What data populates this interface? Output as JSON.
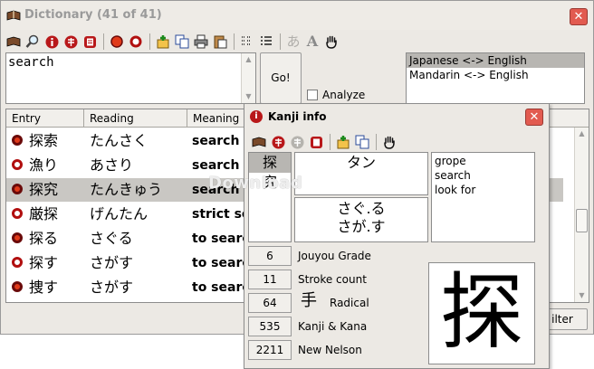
{
  "main_window": {
    "title": "Dictionary (41 of 41)",
    "close_label": "✕"
  },
  "toolbar": {
    "icons": [
      "book-icon",
      "magnifier-icon",
      "info-icon",
      "sound-icon",
      "jump-icon",
      "record-icon",
      "record-outline-icon",
      "add-icon",
      "copy-icon",
      "print-icon",
      "paste-icon",
      "grid-icon",
      "list-icon",
      "font-a-light-icon",
      "font-a-icon",
      "hand-icon"
    ]
  },
  "search": {
    "value": "search"
  },
  "go_button": {
    "label": "Go!"
  },
  "analyze": {
    "label": "Analyze",
    "checked": false
  },
  "languages": {
    "items": [
      "Japanese <-> English",
      "Mandarin <-> English"
    ],
    "selected_index": 0
  },
  "results": {
    "columns": [
      "Entry",
      "Reading",
      "Meaning"
    ],
    "rows": [
      {
        "entry": "探索",
        "reading": "たんさく",
        "meaning": "search",
        "dot": "filled",
        "selected": false
      },
      {
        "entry": "漁り",
        "reading": "あさり",
        "meaning": "search",
        "dot": "outline",
        "selected": false
      },
      {
        "entry": "探究",
        "reading": "たんきゅう",
        "meaning": "search",
        "dot": "filled",
        "selected": true
      },
      {
        "entry": "厳探",
        "reading": "げんたん",
        "meaning": "strict se",
        "dot": "outline",
        "selected": false
      },
      {
        "entry": "探る",
        "reading": "さぐる",
        "meaning": "to searc",
        "dot": "filled",
        "selected": false
      },
      {
        "entry": "探す",
        "reading": "さがす",
        "meaning": "to searc",
        "dot": "outline",
        "selected": false
      },
      {
        "entry": "捜す",
        "reading": "さがす",
        "meaning": "to searc",
        "dot": "filled",
        "selected": false
      }
    ]
  },
  "filter_button": {
    "label": "ilter"
  },
  "kanji_dialog": {
    "title": "Kanji info",
    "close_label": "✕",
    "toolbar_icons": [
      "book-icon",
      "sound-icon",
      "sound-disabled-icon",
      "jump-icon",
      "add-icon",
      "copy-icon",
      "hand-icon"
    ],
    "kanji_list": [
      "探",
      "究"
    ],
    "selected_kanji_index": 0,
    "on_reading": "タン",
    "kun_readings": [
      "さぐ.る",
      "さが.す"
    ],
    "meanings": [
      "grope",
      "search",
      "look for"
    ],
    "stats": [
      {
        "value": "6",
        "label": "Jouyou Grade"
      },
      {
        "value": "11",
        "label": "Stroke count"
      },
      {
        "value": "64",
        "label": "Radical",
        "glyph": "手"
      },
      {
        "value": "535",
        "label": "Kanji & Kana"
      },
      {
        "value": "2211",
        "label": "New Nelson"
      }
    ],
    "big_kanji": "探"
  },
  "watermark": "Download"
}
